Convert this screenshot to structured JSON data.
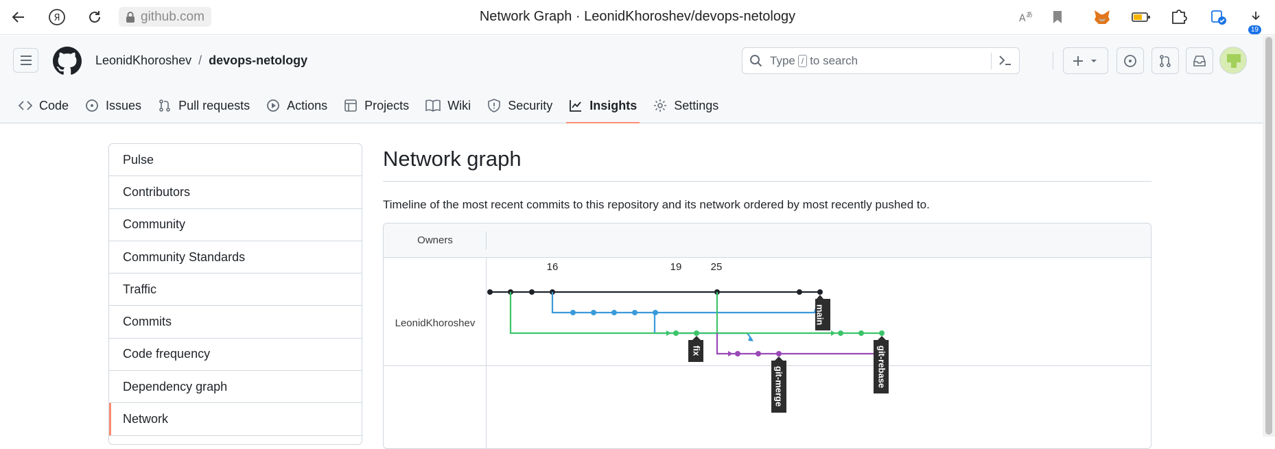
{
  "browser": {
    "address": "github.com",
    "tab_title": "Network Graph · LeonidKhoroshev/devops-netology",
    "download_badge": "19"
  },
  "header": {
    "owner": "LeonidKhoroshev",
    "separator": "/",
    "repo": "devops-netology",
    "search_prefix": "Type",
    "search_key": "/",
    "search_suffix": "to search"
  },
  "repo_nav": [
    {
      "label": "Code",
      "icon": "code-icon"
    },
    {
      "label": "Issues",
      "icon": "issue-icon"
    },
    {
      "label": "Pull requests",
      "icon": "pull-request-icon"
    },
    {
      "label": "Actions",
      "icon": "play-icon"
    },
    {
      "label": "Projects",
      "icon": "table-icon"
    },
    {
      "label": "Wiki",
      "icon": "book-icon"
    },
    {
      "label": "Security",
      "icon": "shield-icon"
    },
    {
      "label": "Insights",
      "icon": "graph-icon",
      "selected": true
    },
    {
      "label": "Settings",
      "icon": "gear-icon"
    }
  ],
  "sidebar": {
    "items": [
      {
        "label": "Pulse"
      },
      {
        "label": "Contributors"
      },
      {
        "label": "Community"
      },
      {
        "label": "Community Standards"
      },
      {
        "label": "Traffic"
      },
      {
        "label": "Commits"
      },
      {
        "label": "Code frequency"
      },
      {
        "label": "Dependency graph"
      },
      {
        "label": "Network",
        "active": true
      }
    ]
  },
  "main": {
    "title": "Network graph",
    "description": "Timeline of the most recent commits to this repository and its network ordered by most recently pushed to."
  },
  "graph": {
    "owners_header": "Owners",
    "owner": "LeonidKhoroshev",
    "dates": [
      "16",
      "19",
      "25"
    ],
    "branches": [
      "main",
      "fix",
      "git-merge",
      "git-rebase"
    ],
    "colors": {
      "main": "#1f2328",
      "blue": "#3a9ad9",
      "green": "#3cc46a",
      "purple": "#9a48b8"
    }
  }
}
